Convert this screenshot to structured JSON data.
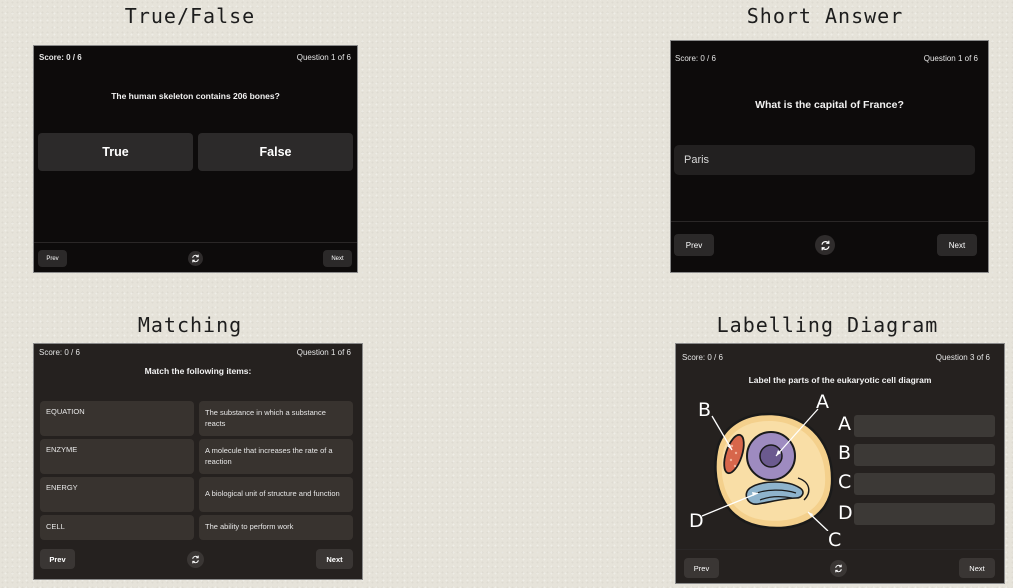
{
  "sections": {
    "true_false": "True/False",
    "short_answer": "Short Answer",
    "matching": "Matching",
    "labelling": "Labelling Diagram"
  },
  "true_false": {
    "score": "Score: 0 / 6",
    "question_num": "Question 1 of 6",
    "question": "The human skeleton contains 206 bones?",
    "true_label": "True",
    "false_label": "False",
    "prev": "Prev",
    "next": "Next",
    "refresh_icon": "refresh-icon"
  },
  "short_answer": {
    "score": "Score: 0 / 6",
    "question_num": "Question 1 of 6",
    "question": "What is the capital of France?",
    "answer_value": "Paris",
    "prev": "Prev",
    "next": "Next",
    "refresh_icon": "refresh-icon"
  },
  "matching": {
    "score": "Score: 0 / 6",
    "question_num": "Question 1 of 6",
    "question": "Match the following items:",
    "left_items": [
      "EQUATION",
      "ENZYME",
      "ENERGY",
      "CELL"
    ],
    "right_items": [
      "The substance in which a substance reacts",
      "A molecule that increases the rate of a reaction",
      "A biological unit of structure and function",
      "The ability to perform work"
    ],
    "prev": "Prev",
    "next": "Next",
    "refresh_icon": "refresh-icon"
  },
  "labelling": {
    "score": "Score: 0 / 6",
    "question_num": "Question 3 of 6",
    "question": "Label the parts of the eukaryotic cell diagram",
    "diagram_letters": [
      "A",
      "B",
      "C",
      "D"
    ],
    "answer_letters": [
      "A",
      "B",
      "C",
      "D"
    ],
    "prev": "Prev",
    "next": "Next",
    "refresh_icon": "refresh-icon"
  },
  "colors": {
    "page_bg": "#e6e3da",
    "card_black": "#0d0b0b",
    "card_gray": "#25211f",
    "button": "#2b2929",
    "cell_fill": "#f6d79a",
    "nucleus": "#a58fc4",
    "mitochondrion": "#e08a6a",
    "er": "#8fb6cf"
  }
}
